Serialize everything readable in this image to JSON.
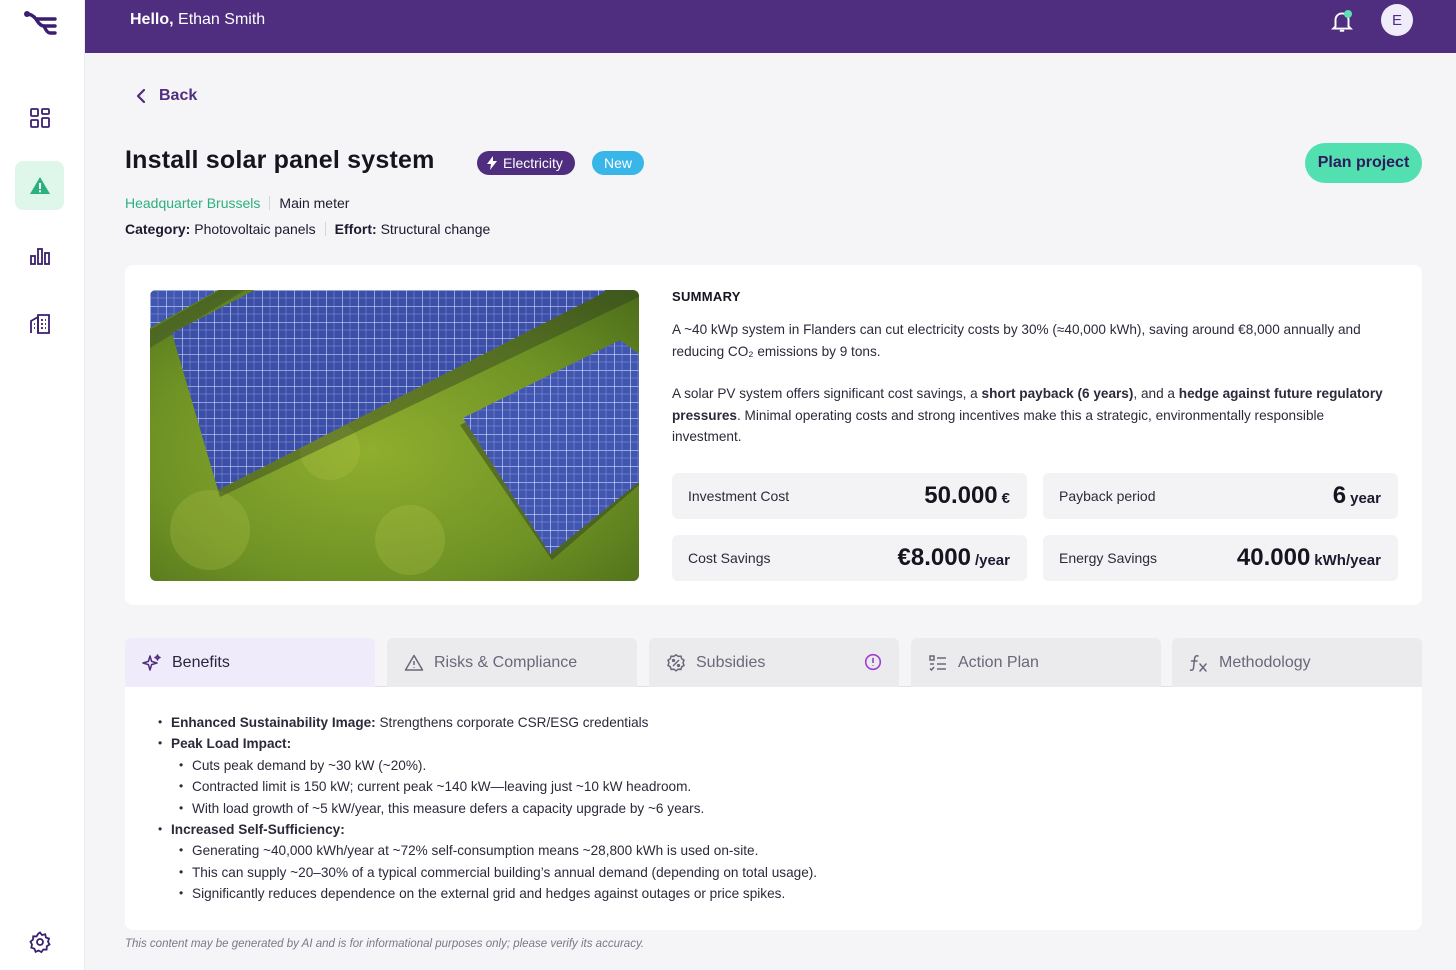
{
  "topbar": {
    "greeting_prefix": "Hello,",
    "user_name": "Ethan Smith",
    "avatar_initial": "E"
  },
  "sidebar": {
    "items": [
      "dashboard-icon",
      "alert-icon",
      "chart-icon",
      "building-icon"
    ],
    "settings": "gear-icon"
  },
  "nav": {
    "back_label": "Back"
  },
  "header": {
    "title": "Install solar panel system",
    "badge_type": "Electricity",
    "badge_status": "New",
    "plan_button": "Plan project",
    "location": "Headquarter Brussels",
    "meter": "Main meter",
    "category_label": "Category:",
    "category_value": "Photovoltaic panels",
    "effort_label": "Effort:",
    "effort_value": "Structural change"
  },
  "summary": {
    "heading": "SUMMARY",
    "p1": "A ~40 kWp system in Flanders can cut electricity costs by 30% (≈40,000 kWh), saving around €8,000 annually and reducing CO₂ emissions by 9 tons.",
    "p2_a": "A solar PV system offers significant cost savings, a ",
    "p2_b": "short payback (6 years)",
    "p2_c": ", and a ",
    "p2_d": "hedge against future regulatory pressures",
    "p2_e": ". Minimal operating costs and strong incentives make this a strategic, environmentally responsible investment."
  },
  "metrics": {
    "investment": {
      "label": "Investment Cost",
      "value": "50.000",
      "unit": "€"
    },
    "payback": {
      "label": "Payback period",
      "value": "6",
      "unit": "year"
    },
    "cost_savings": {
      "label": "Cost Savings",
      "value": "€8.000",
      "unit": "/year"
    },
    "energy_savings": {
      "label": "Energy Savings",
      "value": "40.000",
      "unit": "kWh/year"
    }
  },
  "tabs": [
    "Benefits",
    "Risks & Compliance",
    "Subsidies",
    "Action Plan",
    "Methodology"
  ],
  "benefits": {
    "b1_title": "Enhanced Sustainability Image:",
    "b1_text": " Strengthens corporate CSR/ESG credentials",
    "b2_title": "Peak Load Impact:",
    "b2_items": [
      "Cuts peak demand by ~30 kW (~20%).",
      "Contracted limit is 150 kW; current peak ~140 kW—leaving just ~10 kW headroom.",
      "With load growth of ~5 kW/year, this measure defers a capacity upgrade by ~6 years."
    ],
    "b3_title": "Increased Self-Sufficiency:",
    "b3_items": [
      "Generating ~40,000 kWh/year at ~72% self-consumption means ~28,800 kWh is used on-site.",
      "This can supply ~20–30% of a typical commercial building’s annual demand (depending on total usage).",
      "Significantly reduces dependence on the external grid and hedges against outages or price spikes."
    ]
  },
  "disclaimer": "This content may be generated by AI and is for informational purposes only; please verify its accuracy.",
  "colors": {
    "brand_purple": "#4f2d7f",
    "accent_green": "#53e0b0",
    "badge_blue": "#39b6e8"
  }
}
